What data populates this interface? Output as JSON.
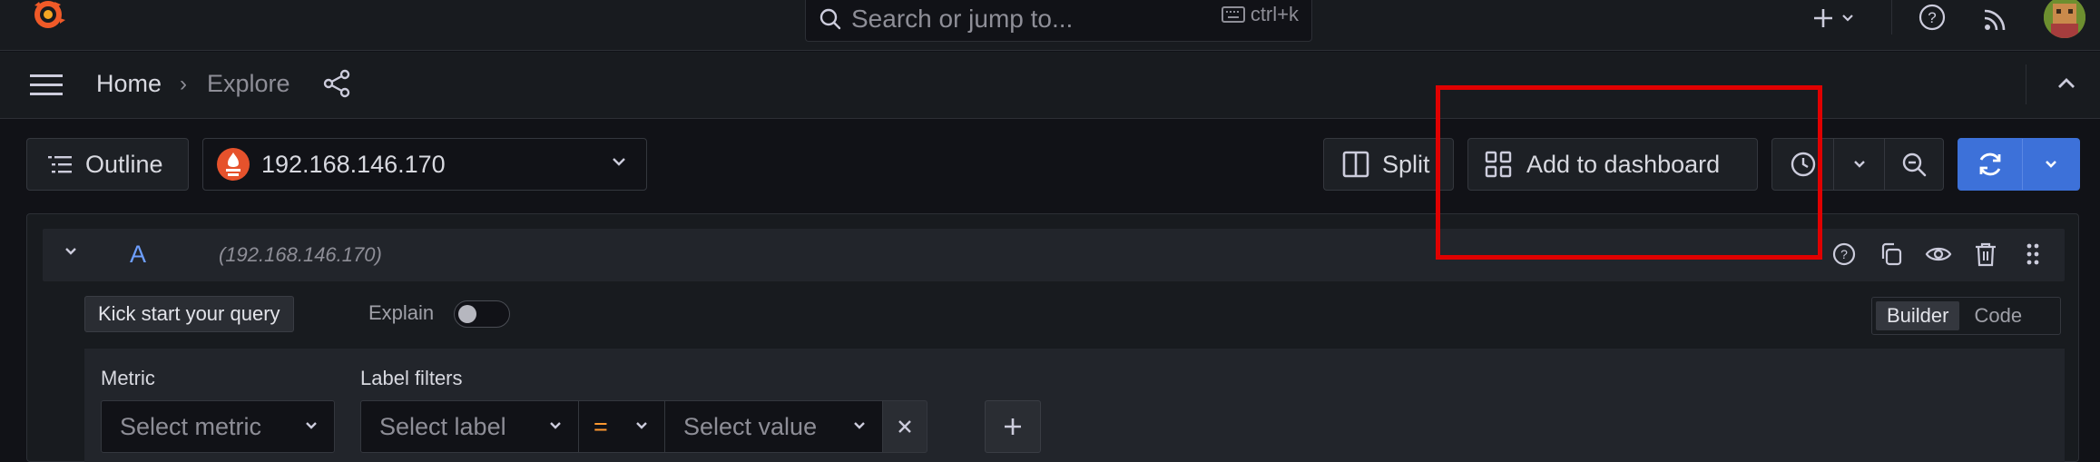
{
  "topbar": {
    "search_placeholder": "Search or jump to...",
    "search_shortcut": "ctrl+k",
    "icons": [
      "grafana-logo",
      "search-icon",
      "keyboard-icon",
      "plus-icon",
      "chevron-down-icon",
      "help-icon",
      "news-icon",
      "avatar"
    ]
  },
  "breadcrumb": {
    "home": "Home",
    "separator": "›",
    "current": "Explore"
  },
  "toolbar": {
    "outline_label": "Outline",
    "datasource_label": "192.168.146.170",
    "split_label": "Split",
    "add_to_dashboard_label": "Add to dashboard"
  },
  "query": {
    "ref_id": "A",
    "datasource_hint": "(192.168.146.170)",
    "kick_start_label": "Kick start your query",
    "explain_label": "Explain",
    "explain_enabled": false,
    "mode_builder": "Builder",
    "mode_code": "Code",
    "active_mode": "Builder",
    "metric_label": "Metric",
    "metric_placeholder": "Select metric",
    "label_filters_label": "Label filters",
    "label_placeholder": "Select label",
    "operator": "=",
    "value_placeholder": "Select value"
  },
  "colors": {
    "background": "#111217",
    "panel": "#181b1f",
    "primary": "#3d71d9",
    "query_letter": "#6e9fff",
    "operator": "#ff9830",
    "highlight": "#e00000",
    "logo": "#f05a28"
  }
}
